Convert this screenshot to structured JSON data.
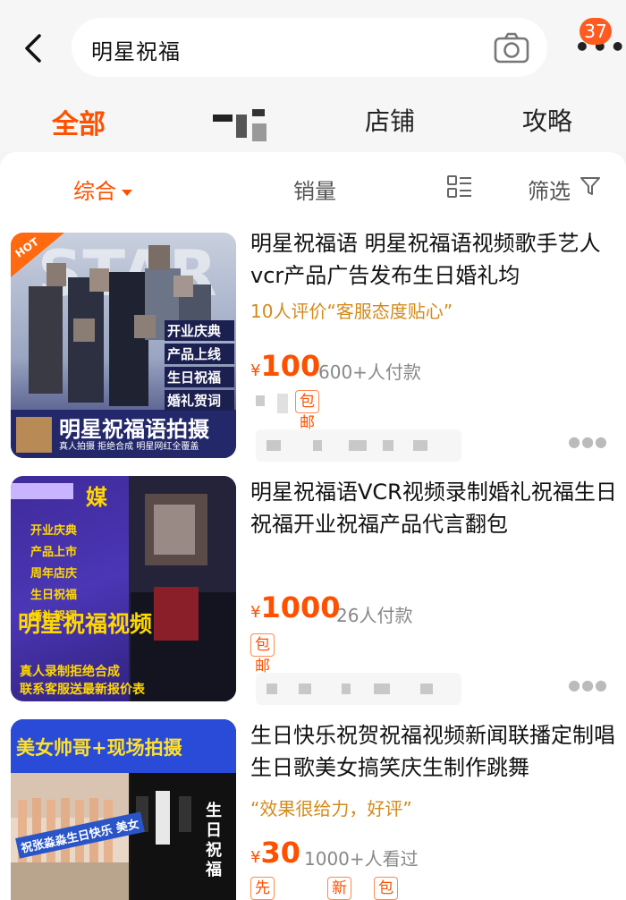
{
  "header": {
    "search_query": "明星祝福",
    "badge_count": "37",
    "more_label": "•••"
  },
  "tabs": [
    {
      "label": "全部",
      "active": true
    },
    {
      "label": "店铺",
      "active": false
    },
    {
      "label": "攻略",
      "active": false
    }
  ],
  "filters": {
    "sort": "综合",
    "sales": "销量",
    "filter": "筛选"
  },
  "products": [
    {
      "title": "明星祝福语 明星祝福语视频歌手艺人vcr产品广告发布生日婚礼均",
      "review": "10人评价“客服态度贴心”",
      "price": "100",
      "currency": "¥",
      "payers": "600+人付款",
      "tags": [
        "包邮"
      ],
      "thumb_text": {
        "hot": "HOT",
        "star": "STAR",
        "items": [
          "开业庆典",
          "产品上线",
          "生日祝福",
          "婚礼贺词"
        ],
        "banner": "明星祝福语拍摄",
        "sub": "真人拍摄  拒绝合成  明星网红全覆盖"
      }
    },
    {
      "title": "明星祝福语VCR视频录制婚礼祝福生日祝福开业祝福产品代言翻包",
      "price": "1000",
      "currency": "¥",
      "payers": "26人付款",
      "tags": [
        "包邮"
      ],
      "thumb_text": {
        "brand": "媒",
        "items": [
          "开业庆典",
          "产品上市",
          "周年店庆",
          "生日祝福",
          "婚礼贺词"
        ],
        "banner": "明星祝福视频",
        "sub1": "真人录制拒绝合成",
        "sub2": "联系客服送最新报价表"
      }
    },
    {
      "title": "生日快乐祝贺祝福视频新闻联播定制唱生日歌美女搞笑庆生制作跳舞",
      "review": "“效果很给力，好评”",
      "price": "30",
      "currency": "¥",
      "payers": "1000+人看过",
      "tags": [
        "先用后付",
        "新品",
        "包邮"
      ],
      "thumb_text": {
        "top": "美女帅哥+现场拍摄",
        "banner": "祝张淼淼生日快乐 美女",
        "side": "生日祝福"
      }
    }
  ],
  "colors": {
    "accent": "#ff5000",
    "review": "#d48a1a",
    "badge": "#ff5a1f"
  },
  "icons": [
    "back-icon",
    "camera-icon",
    "more-icon",
    "list-view-icon",
    "filter-funnel-icon",
    "caret-down-icon",
    "ellipsis-icon"
  ]
}
